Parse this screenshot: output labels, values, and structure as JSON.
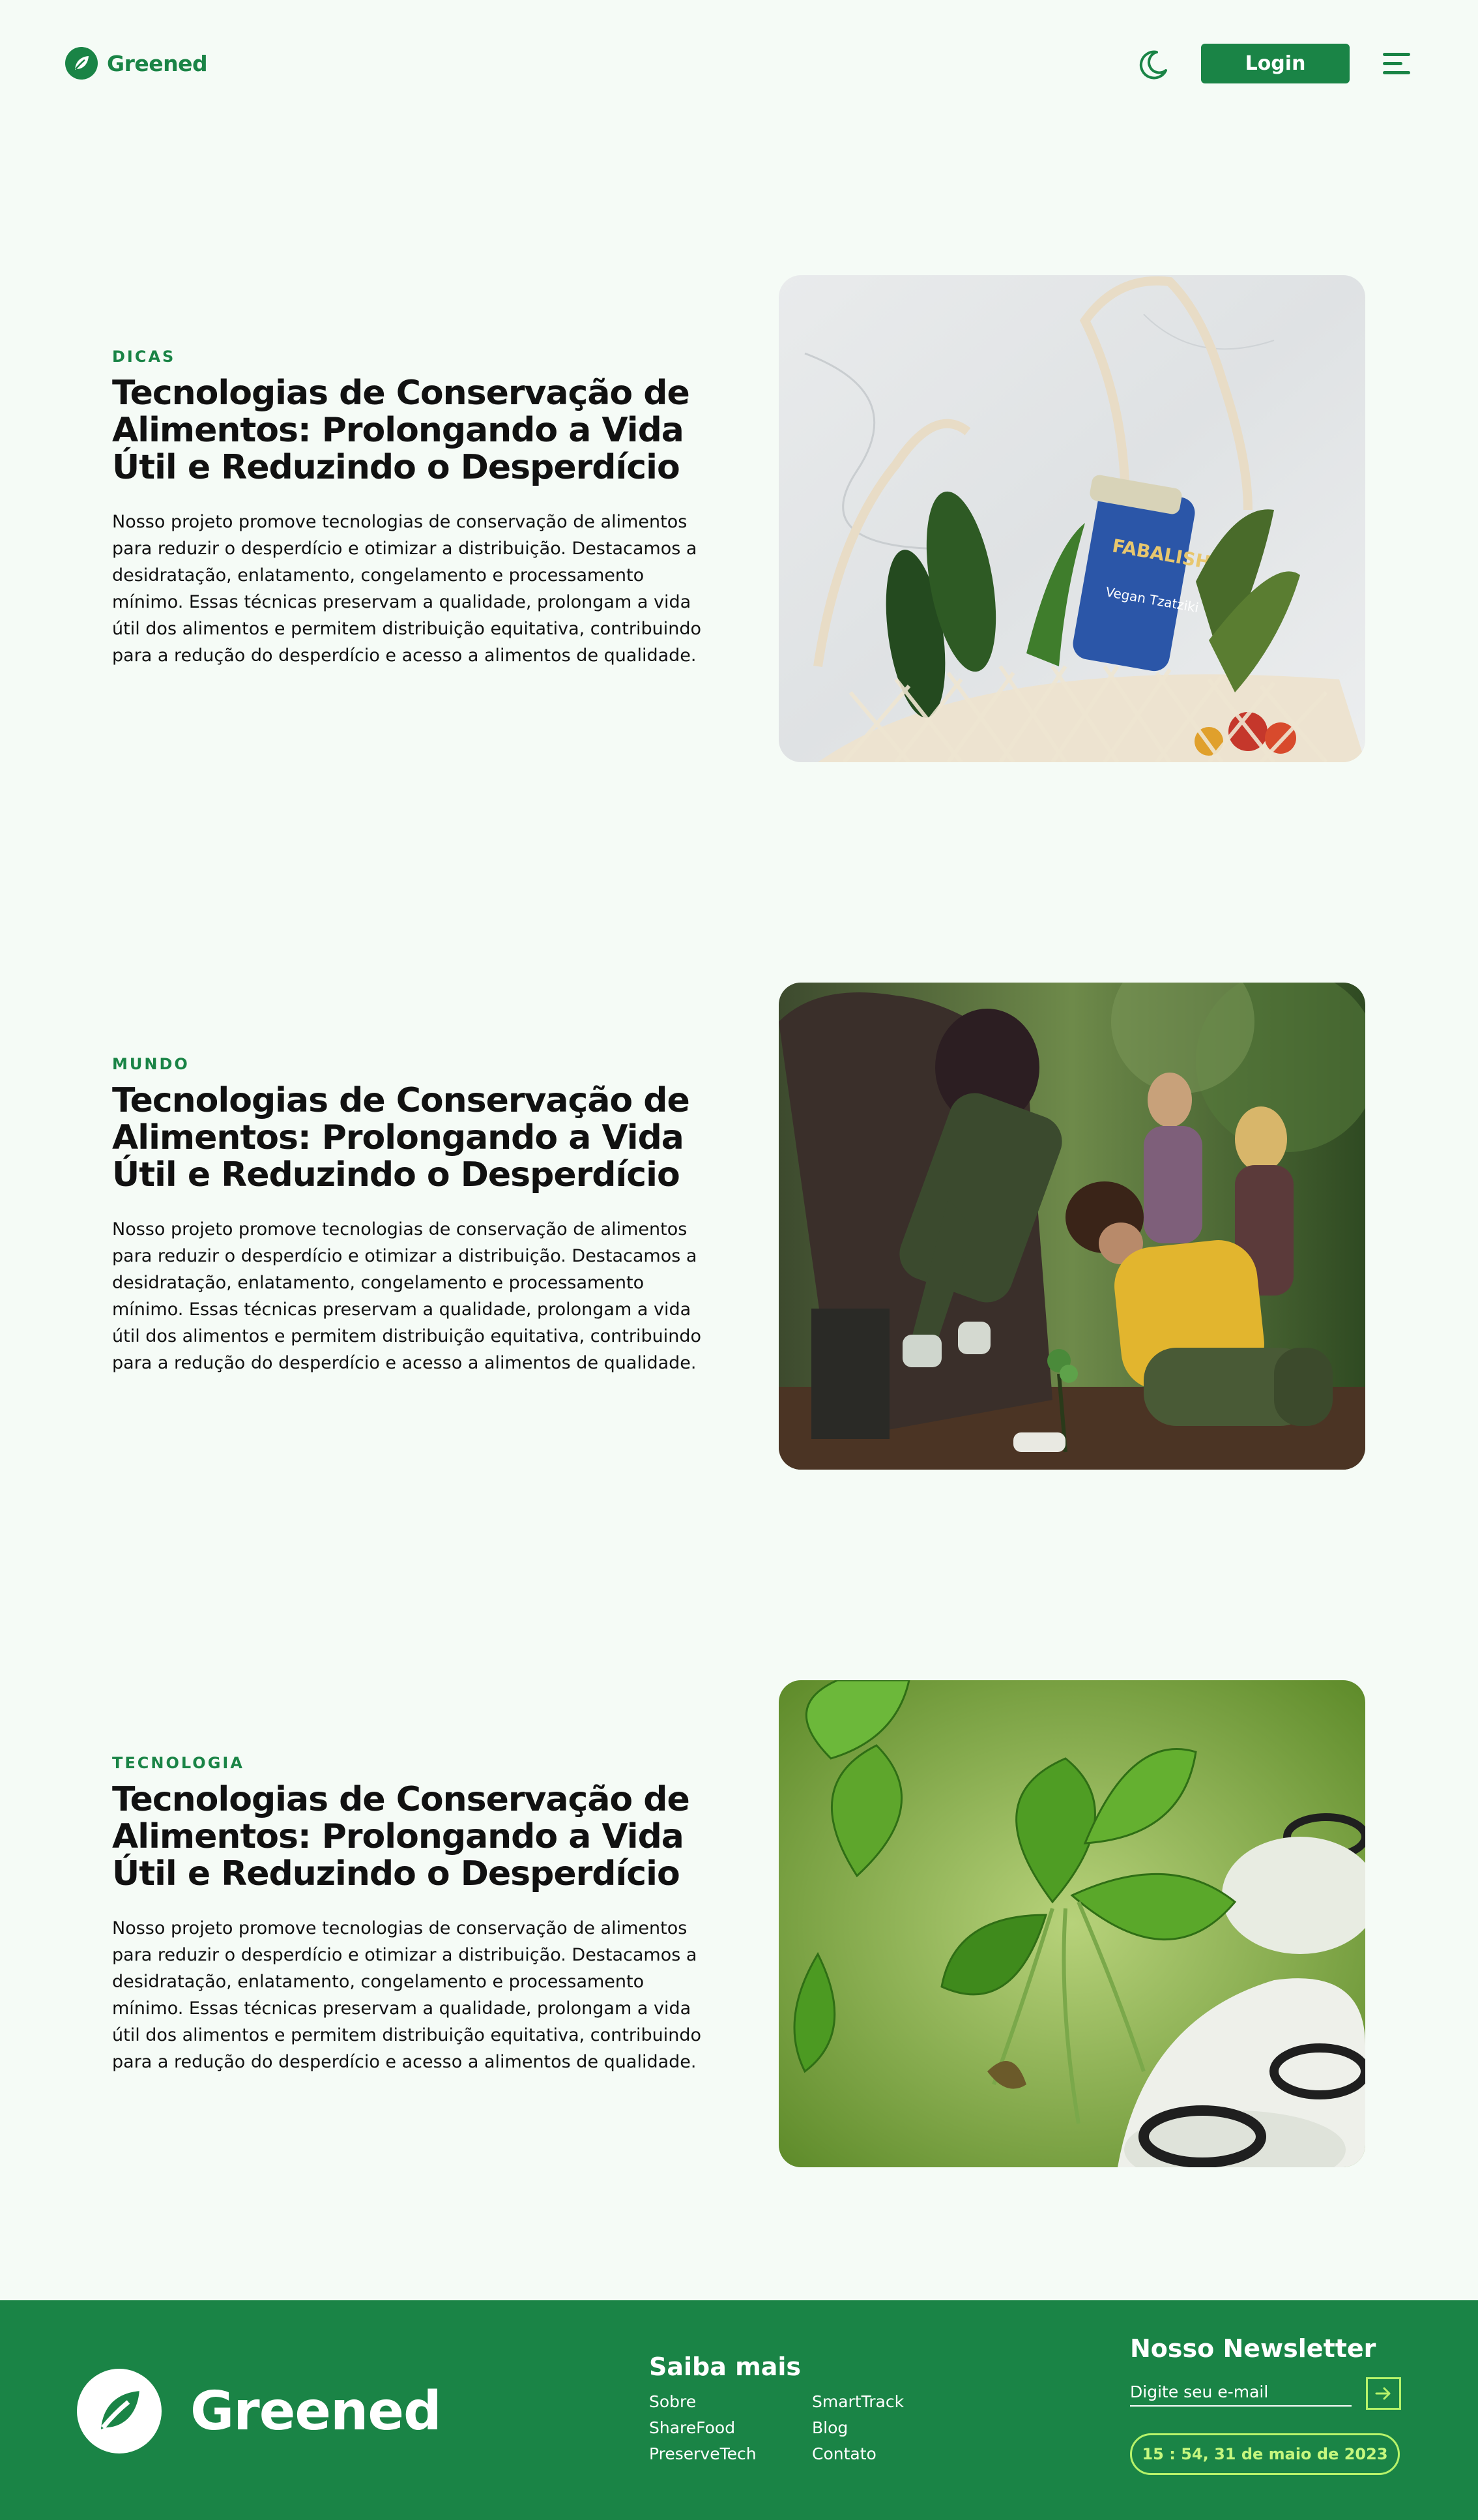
{
  "brand": {
    "name": "Greened"
  },
  "header": {
    "login_label": "Login"
  },
  "articles": [
    {
      "category": "DICAS",
      "title": "Tecnologias de Conservação de Alimentos: Prolongando a Vida Útil e Reduzindo o Desperdício",
      "description": "Nosso projeto promove tecnologias de conservação de alimentos para reduzir o desperdício e otimizar a distribuição. Destacamos a desidratação, enlatamento, congelamento e processamento mínimo. Essas técnicas preservam a qualidade, prolongam a vida útil dos alimentos e permitem distribuição equitativa, contribuindo para a redução do desperdício e acesso a alimentos de qualidade.",
      "image_subject": "mesh-bag-with-cucumbers-herbs-and-jar",
      "jar_label": "FABALISH",
      "jar_sub": "Vegan Tzatziki"
    },
    {
      "category": "MUNDO",
      "title": "Tecnologias de Conservação de Alimentos: Prolongando a Vida Útil e Reduzindo o Desperdício",
      "description": "Nosso projeto promove tecnologias de conservação de alimentos para reduzir o desperdício e otimizar a distribuição. Destacamos a desidratação, enlatamento, congelamento e processamento mínimo. Essas técnicas preservam a qualidade, prolongam a vida útil dos alimentos e permitem distribuição equitativa, contribuindo para a redução do desperdício e acesso a alimentos de qualidade.",
      "image_subject": "people-planting-trees"
    },
    {
      "category": "TECNOLOGIA",
      "title": "Tecnologias de Conservação de Alimentos: Prolongando a Vida Útil e Reduzindo o Desperdício",
      "description": "Nosso projeto promove tecnologias de conservação de alimentos para reduzir o desperdício e otimizar a distribuição. Destacamos a desidratação, enlatamento, congelamento e processamento mínimo. Essas técnicas preservam a qualidade, prolongam a vida útil dos alimentos e permitem distribuição equitativa, contribuindo para a redução do desperdício e acesso a alimentos de qualidade.",
      "image_subject": "hydroponic-strawberry-plants"
    }
  ],
  "footer": {
    "brand": "Greened",
    "links_title": "Saiba mais",
    "links": [
      "Sobre",
      "SmartTrack",
      "ShareFood",
      "Blog",
      "PreserveTech",
      "Contato"
    ],
    "newsletter_title": "Nosso Newsletter",
    "email_placeholder": "Digite seu e-mail",
    "clock": "15 : 54, 31 de maio de 2023"
  },
  "colors": {
    "brand_green": "#1a8446",
    "background": "#f5fbf6",
    "accent_lime": "#b6f36a"
  },
  "icons": [
    "leaf-logo-icon",
    "moon-icon",
    "hamburger-menu-icon",
    "arrow-right-icon"
  ]
}
